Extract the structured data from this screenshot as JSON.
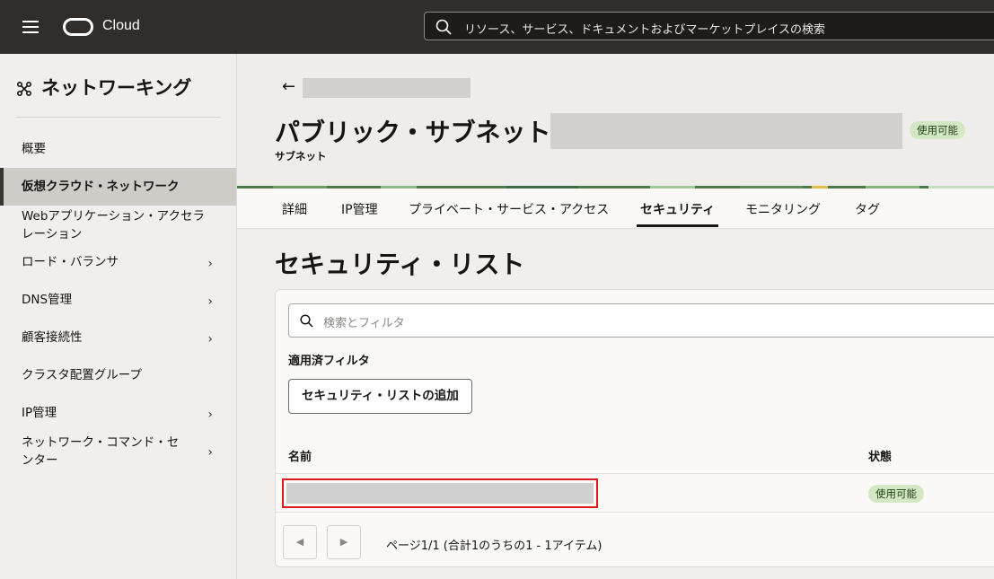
{
  "topbar": {
    "brand": "Cloud",
    "search_placeholder": "リソース、サービス、ドキュメントおよびマーケットプレイスの検索"
  },
  "sidebar": {
    "title": "ネットワーキング",
    "items": [
      {
        "label": "概要",
        "active": false,
        "has_children": false
      },
      {
        "label": "仮想クラウド・ネットワーク",
        "active": true,
        "has_children": false
      },
      {
        "label": "Webアプリケーション・アクセラ",
        "label2": "レーション",
        "active": false,
        "has_children": false
      },
      {
        "label": "ロード・バランサ",
        "active": false,
        "has_children": true
      },
      {
        "label": "DNS管理",
        "active": false,
        "has_children": true
      },
      {
        "label": "顧客接続性",
        "active": false,
        "has_children": true
      },
      {
        "label": "クラスタ配置グループ",
        "active": false,
        "has_children": false
      },
      {
        "label": "IP管理",
        "active": false,
        "has_children": true
      },
      {
        "label": "ネットワーク・コマンド・セ",
        "label2": "ンター",
        "active": false,
        "has_children": true
      }
    ]
  },
  "header": {
    "title": "パブリック・サブネット",
    "subtitle": "サブネット",
    "status": "使用可能"
  },
  "tabs": [
    {
      "label": "詳細",
      "active": false
    },
    {
      "label": "IP管理",
      "active": false
    },
    {
      "label": "プライベート・サービス・アクセス",
      "active": false
    },
    {
      "label": "セキュリティ",
      "active": true
    },
    {
      "label": "モニタリング",
      "active": false
    },
    {
      "label": "タグ",
      "active": false
    }
  ],
  "content": {
    "section_title": "セキュリティ・リスト",
    "filter_placeholder": "検索とフィルタ",
    "applied_filters": "適用済フィルタ",
    "add_button": "セキュリティ・リストの追加",
    "columns": {
      "name": "名前",
      "state": "状態"
    },
    "rows": [
      {
        "name": "",
        "state": "使用可能"
      }
    ],
    "pagination_text": "ページ1/1 (合計1のうちの1 - 1アイテム)"
  },
  "colors": {
    "topbar": "#312d2a",
    "badge_bg": "#d4e7c4",
    "highlight": "#e0191d"
  }
}
